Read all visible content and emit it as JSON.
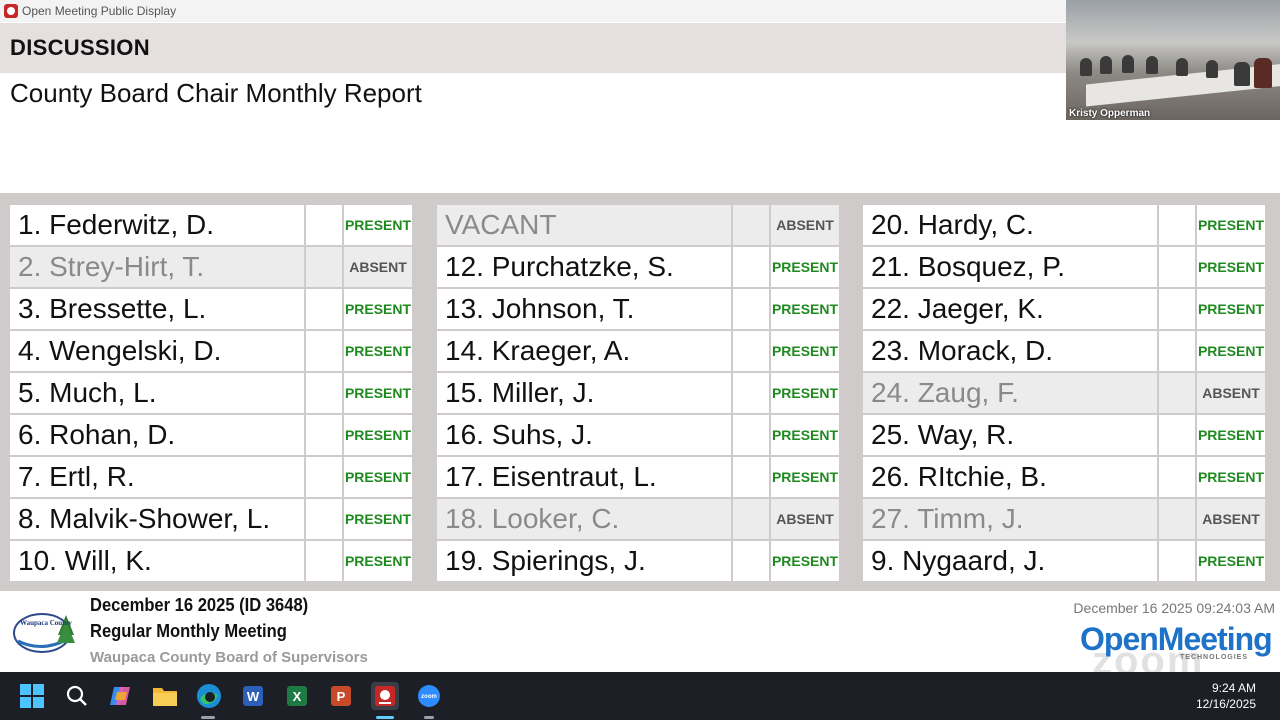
{
  "window": {
    "title": "Open Meeting Public Display"
  },
  "agenda": {
    "heading": "DISCUSSION",
    "item": "County Board Chair Monthly Report"
  },
  "video": {
    "participant": "Kristy Opperman"
  },
  "roll_call": {
    "columns": [
      [
        {
          "name": "1. Federwitz, D.",
          "status": "PRESENT"
        },
        {
          "name": "2. Strey-Hirt, T.",
          "status": "ABSENT"
        },
        {
          "name": "3. Bressette, L.",
          "status": "PRESENT"
        },
        {
          "name": "4. Wengelski, D.",
          "status": "PRESENT"
        },
        {
          "name": "5. Much, L.",
          "status": "PRESENT"
        },
        {
          "name": "6. Rohan, D.",
          "status": "PRESENT"
        },
        {
          "name": "7. Ertl, R.",
          "status": "PRESENT"
        },
        {
          "name": "8. Malvik-Shower, L.",
          "status": "PRESENT"
        },
        {
          "name": "10. Will, K.",
          "status": "PRESENT"
        }
      ],
      [
        {
          "name": "VACANT",
          "status": "ABSENT"
        },
        {
          "name": "12. Purchatzke, S.",
          "status": "PRESENT"
        },
        {
          "name": "13. Johnson, T.",
          "status": "PRESENT"
        },
        {
          "name": "14. Kraeger, A.",
          "status": "PRESENT"
        },
        {
          "name": "15. Miller, J.",
          "status": "PRESENT"
        },
        {
          "name": "16. Suhs, J.",
          "status": "PRESENT"
        },
        {
          "name": "17. Eisentraut, L.",
          "status": "PRESENT"
        },
        {
          "name": "18. Looker, C.",
          "status": "ABSENT"
        },
        {
          "name": "19. Spierings, J.",
          "status": "PRESENT"
        }
      ],
      [
        {
          "name": "20. Hardy, C.",
          "status": "PRESENT"
        },
        {
          "name": "21. Bosquez, P.",
          "status": "PRESENT"
        },
        {
          "name": "22. Jaeger, K.",
          "status": "PRESENT"
        },
        {
          "name": "23. Morack, D.",
          "status": "PRESENT"
        },
        {
          "name": "24. Zaug, F.",
          "status": "ABSENT"
        },
        {
          "name": "25. Way, R.",
          "status": "PRESENT"
        },
        {
          "name": "26. RItchie, B.",
          "status": "PRESENT"
        },
        {
          "name": "27. Timm, J.",
          "status": "ABSENT"
        },
        {
          "name": "9. Nygaard, J.",
          "status": "PRESENT"
        }
      ]
    ]
  },
  "meeting": {
    "date_line": "December 16 2025 (ID 3648)",
    "type": "Regular Monthly Meeting",
    "board": "Waupaca County Board of Supervisors",
    "timestamp": "December 16 2025 09:24:03 AM",
    "county_logo_text": "Waupaca County",
    "brand": "OpenMeeting",
    "brand_tagline": "TECHNOLOGIES",
    "watermark": "zoom"
  },
  "colors": {
    "present": "#1f8a1f",
    "absent_text": "#8a8a8a",
    "brand": "#1e73c8",
    "taskbar": "#1c1f26"
  },
  "taskbar": {
    "icons": [
      "windows-start-icon",
      "search-icon",
      "copilot-icon",
      "file-explorer-icon",
      "edge-icon",
      "word-icon",
      "excel-icon",
      "powerpoint-icon",
      "open-meeting-icon",
      "zoom-icon"
    ],
    "word_letter": "W",
    "excel_letter": "X",
    "ppt_letter": "P",
    "zoom_label": "zoom",
    "time": "9:24 AM",
    "date": "12/16/2025"
  }
}
